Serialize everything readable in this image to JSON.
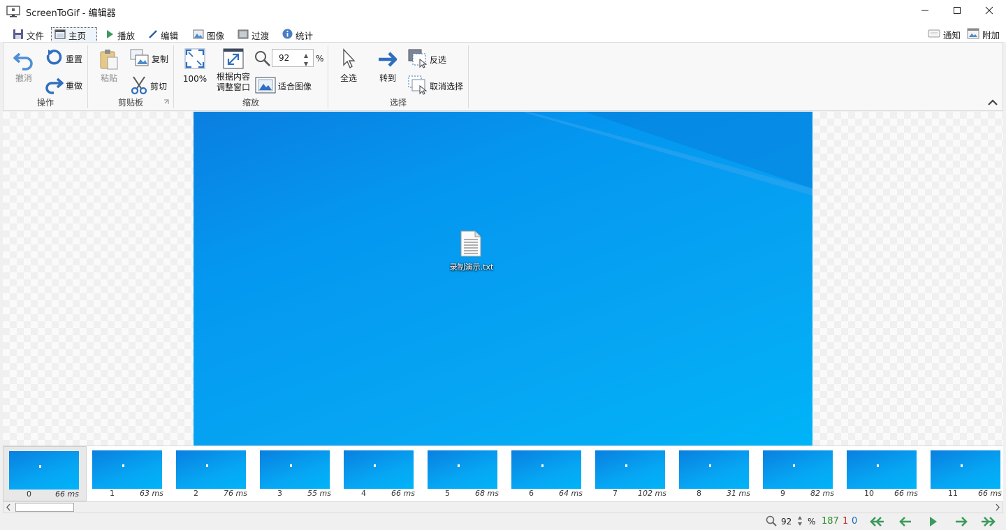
{
  "window": {
    "title": "ScreenToGif - 编辑器",
    "minimize_icon": "minimize-icon",
    "maximize_icon": "maximize-icon",
    "close_icon": "close-icon"
  },
  "tabs": [
    {
      "label": "文件",
      "icon": "save-icon"
    },
    {
      "label": "主页",
      "icon": "home-icon",
      "active": true
    },
    {
      "label": "播放",
      "icon": "play-icon"
    },
    {
      "label": "编辑",
      "icon": "pencil-icon"
    },
    {
      "label": "图像",
      "icon": "image-icon"
    },
    {
      "label": "过渡",
      "icon": "transition-icon"
    },
    {
      "label": "统计",
      "icon": "info-icon"
    }
  ],
  "right_tabs": [
    {
      "label": "通知",
      "icon": "notification-icon"
    },
    {
      "label": "附加",
      "icon": "extras-icon"
    }
  ],
  "ribbon": {
    "action": {
      "label": "操作",
      "undo": "撤消",
      "reset": "重置",
      "redo": "重做"
    },
    "clipboard": {
      "label": "剪贴板",
      "paste": "粘贴",
      "copy": "复制",
      "cut": "剪切"
    },
    "zoom": {
      "label": "缩放",
      "hundred": "100%",
      "fit_window_line1": "根据内容",
      "fit_window_line2": "调整窗口",
      "zoom_value": "92",
      "percent": "%",
      "fit_image": "适合图像"
    },
    "select": {
      "label": "选择",
      "select_all": "全选",
      "goto": "转到",
      "invert": "反选",
      "deselect": "取消选择"
    }
  },
  "preview": {
    "file_label": "录制演示.txt"
  },
  "frames": [
    {
      "index": "0",
      "delay": "66 ms",
      "selected": true
    },
    {
      "index": "1",
      "delay": "63 ms"
    },
    {
      "index": "2",
      "delay": "76 ms"
    },
    {
      "index": "3",
      "delay": "55 ms"
    },
    {
      "index": "4",
      "delay": "66 ms"
    },
    {
      "index": "5",
      "delay": "68 ms"
    },
    {
      "index": "6",
      "delay": "64 ms"
    },
    {
      "index": "7",
      "delay": "102 ms"
    },
    {
      "index": "8",
      "delay": "31 ms"
    },
    {
      "index": "9",
      "delay": "82 ms"
    },
    {
      "index": "10",
      "delay": "66 ms"
    },
    {
      "index": "11",
      "delay": "66 ms"
    }
  ],
  "status": {
    "zoom": "92",
    "percent": "%",
    "total_frames": "187",
    "selected_frames": "1",
    "current_frame": "0",
    "colors": {
      "total": "#2e8b2e",
      "selected": "#c62828",
      "current": "#1565c0",
      "nav": "#3d9a5c"
    }
  }
}
